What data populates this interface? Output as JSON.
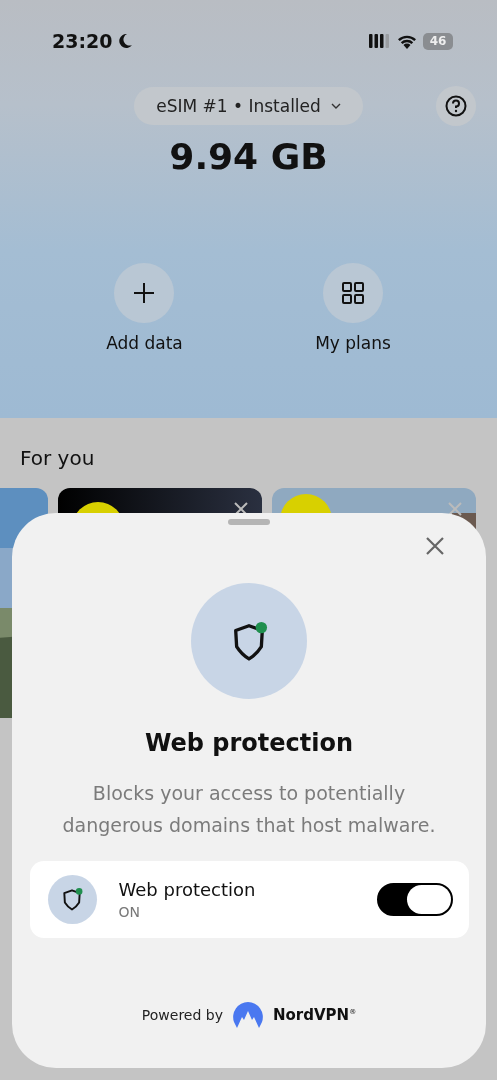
{
  "status_bar": {
    "time": "23:20",
    "battery": "46"
  },
  "header": {
    "esim_selector": "eSIM #1 • Installed",
    "data_remaining": "9.94 GB"
  },
  "actions": [
    {
      "kind": "add",
      "label": "Add data"
    },
    {
      "kind": "plans",
      "label": "My plans"
    }
  ],
  "for_you": {
    "title": "For you",
    "cards": [
      {
        "kind": "photo",
        "dismissible": false
      },
      {
        "kind": "dark",
        "dismissible": true
      },
      {
        "kind": "light",
        "dismissible": true
      }
    ]
  },
  "sheet": {
    "title": "Web protection",
    "description": "Blocks your access to potentially dangerous domains that host malware.",
    "setting": {
      "title": "Web protection",
      "status": "ON",
      "on": true
    },
    "powered_by": "Powered by",
    "brand": "NordVPN$^{®}$"
  }
}
